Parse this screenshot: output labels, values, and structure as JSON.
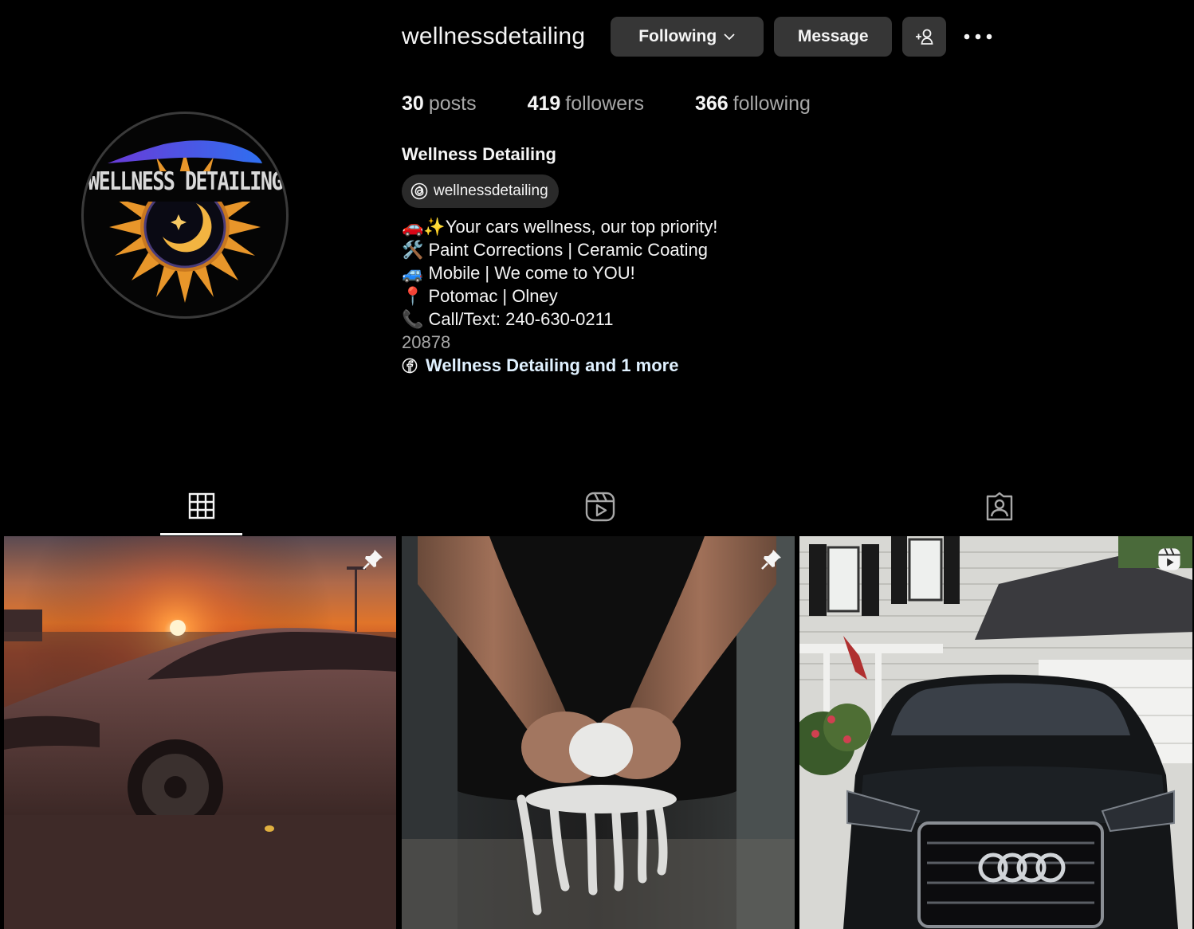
{
  "profile": {
    "username": "wellnessdetailing",
    "full_name": "Wellness Detailing",
    "avatar_logo_text": "WELLNESS DETAILING",
    "threads_handle": "wellnessdetailing"
  },
  "actions": {
    "following_label": "Following",
    "message_label": "Message",
    "add_user_icon": "add-person-icon",
    "more_icon": "more-horizontal-icon"
  },
  "stats": {
    "posts_count": "30",
    "posts_label": "posts",
    "followers_count": "419",
    "followers_label": "followers",
    "following_count": "366",
    "following_label": "following"
  },
  "bio": {
    "lines": [
      "🚗✨Your cars wellness, our top priority!",
      "🛠️ Paint Corrections | Ceramic Coating",
      "🚙 Mobile | We come to YOU!",
      "📍 Potomac | Olney",
      "📞 Call/Text: 240-630-0211"
    ],
    "zip": "20878",
    "links_label": "Wellness Detailing and 1 more"
  },
  "tabs": [
    {
      "icon": "grid-icon",
      "active": true
    },
    {
      "icon": "reels-icon",
      "active": false
    },
    {
      "icon": "tagged-icon",
      "active": false
    }
  ],
  "posts": [
    {
      "subject": "red sedan at sunset",
      "badge": "pin-icon"
    },
    {
      "subject": "hands wringing foam towel",
      "badge": "pin-icon"
    },
    {
      "subject": "black suv in driveway",
      "badge": "reel-icon"
    }
  ],
  "colors": {
    "background": "#000000",
    "button": "#363636",
    "muted_text": "#a8a8a8",
    "link_text": "#e0f1ff"
  }
}
